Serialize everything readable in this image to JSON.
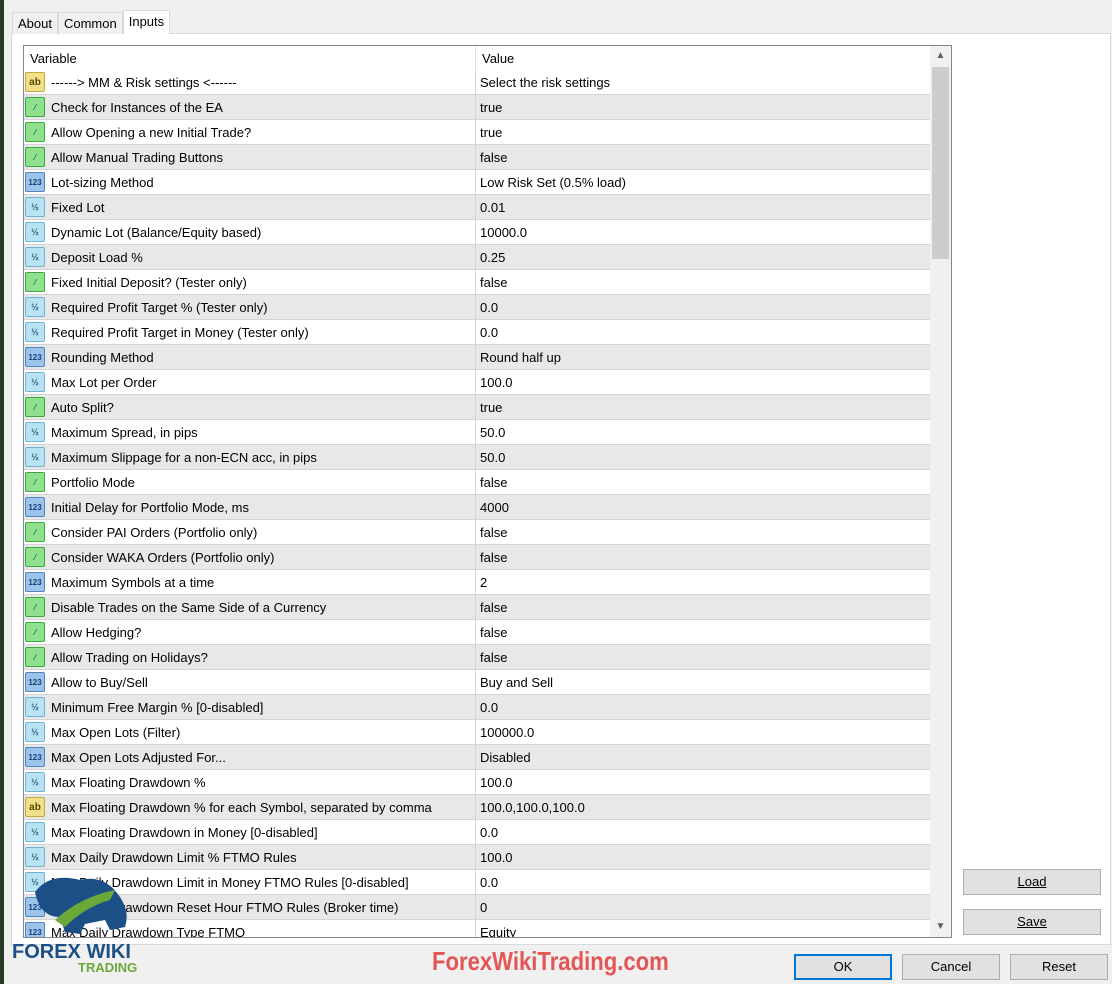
{
  "tabs": [
    "About",
    "Common",
    "Inputs"
  ],
  "columns": {
    "variable": "Variable",
    "value": "Value"
  },
  "rows": [
    {
      "t": "s",
      "n": "------> MM & Risk settings <------",
      "v": "Select the risk settings"
    },
    {
      "t": "b",
      "n": "Check for Instances of the EA",
      "v": "true"
    },
    {
      "t": "b",
      "n": "Allow Opening a new Initial Trade?",
      "v": "true"
    },
    {
      "t": "b",
      "n": "Allow Manual Trading Buttons",
      "v": "false"
    },
    {
      "t": "i",
      "n": "Lot-sizing Method",
      "v": "Low Risk Set (0.5% load)"
    },
    {
      "t": "d",
      "n": "Fixed Lot",
      "v": "0.01"
    },
    {
      "t": "d",
      "n": "Dynamic Lot (Balance/Equity based)",
      "v": "10000.0"
    },
    {
      "t": "d",
      "n": "Deposit Load %",
      "v": "0.25"
    },
    {
      "t": "b",
      "n": "Fixed Initial Deposit? (Tester only)",
      "v": "false"
    },
    {
      "t": "d",
      "n": "Required Profit Target % (Tester only)",
      "v": "0.0"
    },
    {
      "t": "d",
      "n": "Required Profit Target in Money (Tester only)",
      "v": "0.0"
    },
    {
      "t": "i",
      "n": "Rounding Method",
      "v": "Round half up"
    },
    {
      "t": "d",
      "n": "Max Lot per Order",
      "v": "100.0"
    },
    {
      "t": "b",
      "n": "Auto Split?",
      "v": "true"
    },
    {
      "t": "d",
      "n": "Maximum Spread, in pips",
      "v": "50.0"
    },
    {
      "t": "d",
      "n": "Maximum Slippage for a non-ECN acc, in pips",
      "v": "50.0"
    },
    {
      "t": "b",
      "n": "Portfolio Mode",
      "v": "false"
    },
    {
      "t": "i",
      "n": "Initial Delay for Portfolio Mode, ms",
      "v": "4000"
    },
    {
      "t": "b",
      "n": "Consider PAI Orders (Portfolio only)",
      "v": "false"
    },
    {
      "t": "b",
      "n": "Consider WAKA Orders (Portfolio only)",
      "v": "false"
    },
    {
      "t": "i",
      "n": "Maximum Symbols at a time",
      "v": "2"
    },
    {
      "t": "b",
      "n": "Disable Trades on the Same Side of a Currency",
      "v": "false"
    },
    {
      "t": "b",
      "n": "Allow Hedging?",
      "v": "false"
    },
    {
      "t": "b",
      "n": "Allow Trading on Holidays?",
      "v": "false"
    },
    {
      "t": "i",
      "n": "Allow to Buy/Sell",
      "v": "Buy and Sell"
    },
    {
      "t": "d",
      "n": "Minimum Free Margin % [0-disabled]",
      "v": "0.0"
    },
    {
      "t": "d",
      "n": "Max Open Lots (Filter)",
      "v": "100000.0"
    },
    {
      "t": "i",
      "n": "Max Open Lots Adjusted For...",
      "v": "Disabled"
    },
    {
      "t": "d",
      "n": "Max Floating Drawdown %",
      "v": "100.0"
    },
    {
      "t": "s",
      "n": "Max Floating Drawdown % for each Symbol, separated by comma",
      "v": "100.0,100.0,100.0"
    },
    {
      "t": "d",
      "n": "Max Floating Drawdown in Money [0-disabled]",
      "v": "0.0"
    },
    {
      "t": "d",
      "n": "Max Daily Drawdown Limit % FTMO Rules",
      "v": "100.0"
    },
    {
      "t": "d",
      "n": "Max Daily Drawdown Limit in Money FTMO Rules [0-disabled]",
      "v": "0.0"
    },
    {
      "t": "i",
      "n": "Max Daily Drawdown Reset Hour FTMO Rules (Broker time)",
      "v": "0"
    },
    {
      "t": "i",
      "n": "Max Daily Drawdown Type FTMO",
      "v": "Equity"
    }
  ],
  "icon_labels": {
    "s": "ab",
    "b": "⁄",
    "i": "123",
    "d": "½"
  },
  "buttons": {
    "load": "Load",
    "save": "Save",
    "ok": "OK",
    "cancel": "Cancel",
    "reset": "Reset"
  },
  "watermark": "ForexWikiTrading.com",
  "logo": {
    "line1": "FOREX WIKI",
    "line2": "TRADING"
  }
}
